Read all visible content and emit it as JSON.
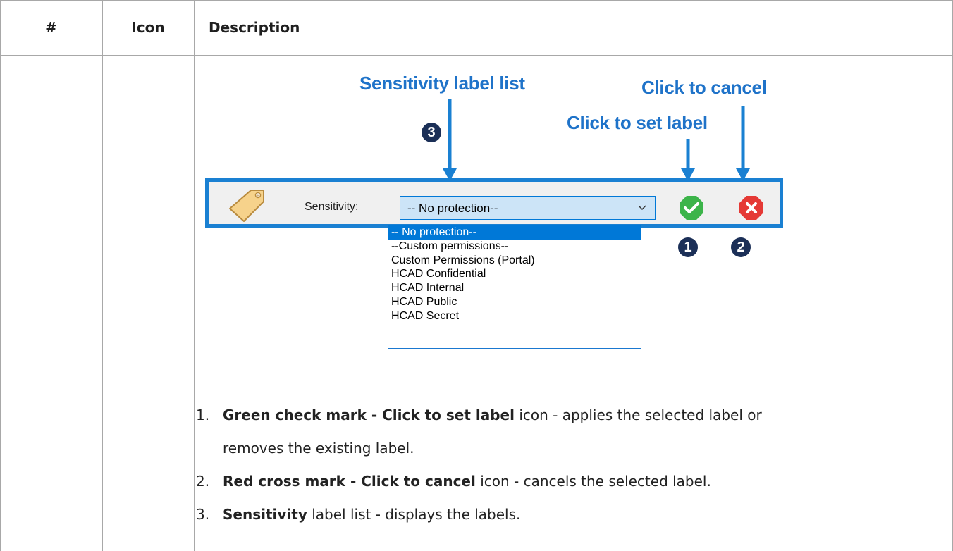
{
  "table": {
    "headers": {
      "num": "#",
      "icon": "Icon",
      "description": "Description"
    }
  },
  "figure": {
    "callouts": {
      "list": "Sensitivity label list",
      "cancel": "Click to cancel",
      "set": "Click to set label"
    },
    "markers": {
      "one": "1",
      "two": "2",
      "three": "3"
    },
    "toolbar": {
      "label": "Sensitivity:",
      "selected": "-- No protection--",
      "icons": {
        "tag": "tag-icon",
        "check": "green-check-icon",
        "cancel": "red-cross-icon",
        "chevron": "chevron-down-icon"
      }
    },
    "dropdown": [
      "-- No protection--",
      "--Custom permissions--",
      "Custom Permissions (Portal)",
      "HCAD Confidential",
      "HCAD Internal",
      "HCAD Public",
      "HCAD Secret"
    ],
    "colors": {
      "callout": "#1f73c9",
      "frame": "#1a80d2",
      "check": "#3cb44a",
      "cancel": "#e53935",
      "marker": "#1b2f57"
    }
  },
  "description": [
    {
      "num": "1.",
      "bold": "Green check mark - Click to set label",
      "rest_a": " icon - applies the selected label or",
      "rest_b": "removes the existing label."
    },
    {
      "num": "2.",
      "bold": "Red cross mark - Click to cancel",
      "rest_a": " icon - cancels the selected label."
    },
    {
      "num": "3.",
      "bold": "Sensitivity",
      "rest_a": " label list - displays the labels."
    }
  ]
}
